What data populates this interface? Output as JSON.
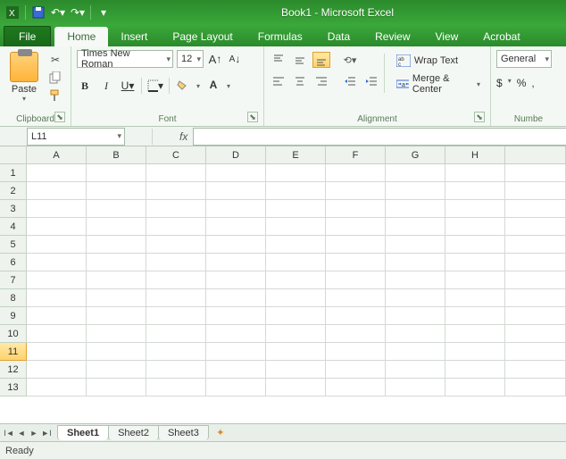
{
  "title": "Book1 - Microsoft Excel",
  "tabs": {
    "file": "File",
    "home": "Home",
    "insert": "Insert",
    "pagelayout": "Page Layout",
    "formulas": "Formulas",
    "data": "Data",
    "review": "Review",
    "view": "View",
    "acrobat": "Acrobat"
  },
  "clipboard": {
    "paste": "Paste",
    "label": "Clipboard"
  },
  "font": {
    "name": "Times New Roman",
    "size": "12",
    "grow": "A",
    "shrink": "A",
    "bold": "B",
    "italic": "I",
    "underline": "U",
    "fontcolor_hex": "#c00000",
    "fillcolor_hex": "#ffff00",
    "label": "Font"
  },
  "alignment": {
    "wrap": "Wrap Text",
    "merge": "Merge & Center",
    "label": "Alignment"
  },
  "number": {
    "format": "General",
    "currency": "$",
    "percent": "%",
    "comma": ",",
    "label": "Numbe"
  },
  "namebox": "L11",
  "fx_label": "fx",
  "columns": [
    "A",
    "B",
    "C",
    "D",
    "E",
    "F",
    "G",
    "H"
  ],
  "rows": [
    "1",
    "2",
    "3",
    "4",
    "5",
    "6",
    "7",
    "8",
    "9",
    "10",
    "11",
    "12",
    "13"
  ],
  "selected_row": "11",
  "sheets": {
    "s1": "Sheet1",
    "s2": "Sheet2",
    "s3": "Sheet3"
  },
  "status": "Ready"
}
